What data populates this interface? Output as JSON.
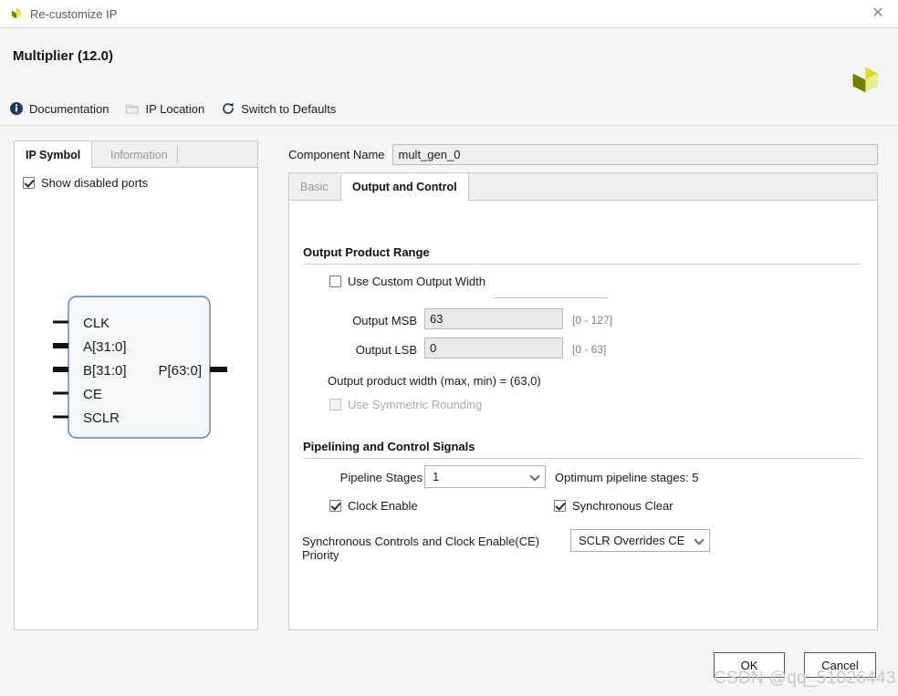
{
  "window": {
    "title": "Re-customize IP",
    "close_label": "✕",
    "logo_name": "xilinx-logo"
  },
  "header": {
    "title": "Multiplier (12.0)",
    "toolbar": [
      {
        "label": "Documentation",
        "icon": "info-icon"
      },
      {
        "label": "IP Location",
        "icon": "folder-icon"
      },
      {
        "label": "Switch to Defaults",
        "icon": "refresh-icon"
      }
    ]
  },
  "left_panel": {
    "tabs": [
      {
        "label": "IP Symbol",
        "active": true
      },
      {
        "label": "Information",
        "active": false
      }
    ],
    "show_disabled_ports": {
      "label": "Show disabled ports",
      "checked": true
    },
    "symbol": {
      "inputs": [
        {
          "label": "CLK",
          "bus": false
        },
        {
          "label": "A[31:0]",
          "bus": true
        },
        {
          "label": "B[31:0]",
          "bus": true
        },
        {
          "label": "CE",
          "bus": false
        },
        {
          "label": "SCLR",
          "bus": false
        }
      ],
      "outputs": [
        {
          "label": "P[63:0]",
          "bus": true
        }
      ]
    }
  },
  "main": {
    "component_name": {
      "label": "Component Name",
      "value": "mult_gen_0"
    },
    "tabs": [
      {
        "label": "Basic",
        "active": false
      },
      {
        "label": "Output and Control",
        "active": true
      }
    ],
    "output_product_range": {
      "title": "Output Product Range",
      "use_custom_output_width": {
        "label": "Use Custom Output Width",
        "checked": false
      },
      "output_msb": {
        "label": "Output MSB",
        "value": "63",
        "range": "[0 - 127]"
      },
      "output_lsb": {
        "label": "Output LSB",
        "value": "0",
        "range": "[0 - 63]"
      },
      "width_note": "Output product width (max, min) = (63,0)",
      "use_symmetric_rounding": {
        "label": "Use Symmetric Rounding",
        "checked": false,
        "disabled": true
      }
    },
    "pipelining": {
      "title": "Pipelining and Control Signals",
      "pipeline_stages": {
        "label": "Pipeline Stages",
        "value": "1"
      },
      "optimum_note": "Optimum pipeline stages: 5",
      "clock_enable": {
        "label": "Clock Enable",
        "checked": true
      },
      "synchronous_clear": {
        "label": "Synchronous Clear",
        "checked": true
      },
      "priority": {
        "label": "Synchronous Controls and Clock Enable(CE) Priority",
        "value": "SCLR Overrides CE"
      }
    }
  },
  "footer": {
    "ok_label": "OK",
    "cancel_label": "Cancel"
  },
  "watermark": "CSDN @qq_51026443"
}
